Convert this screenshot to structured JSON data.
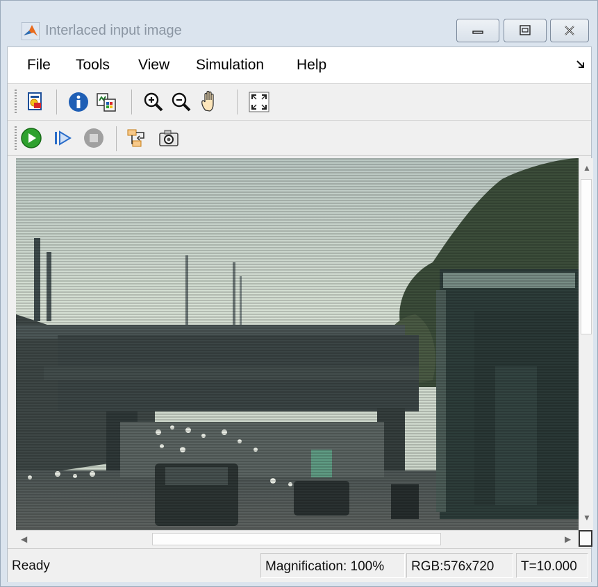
{
  "window": {
    "title": "Interlaced input image"
  },
  "menubar": {
    "items": [
      "File",
      "Tools",
      "View",
      "Simulation",
      "Help"
    ]
  },
  "toolbar": {
    "row1_icons": [
      "print-icon",
      "info-icon",
      "copy-icon",
      "zoom-in-icon",
      "zoom-out-icon",
      "pan-hand-icon",
      "fit-to-window-icon"
    ],
    "row2_icons": [
      "run-icon",
      "step-forward-icon",
      "stop-icon",
      "highlight-block-icon",
      "snapshot-icon"
    ]
  },
  "image": {
    "description_icon": "video-frame-image"
  },
  "statusbar": {
    "status": "Ready",
    "magnification": "Magnification: 100%",
    "rgb": "RGB:576x720",
    "time": "T=10.000"
  },
  "colors": {
    "run_green": "#2ea12e",
    "info_blue": "#1f5fb5",
    "stop_gray": "#a0a0a0"
  }
}
